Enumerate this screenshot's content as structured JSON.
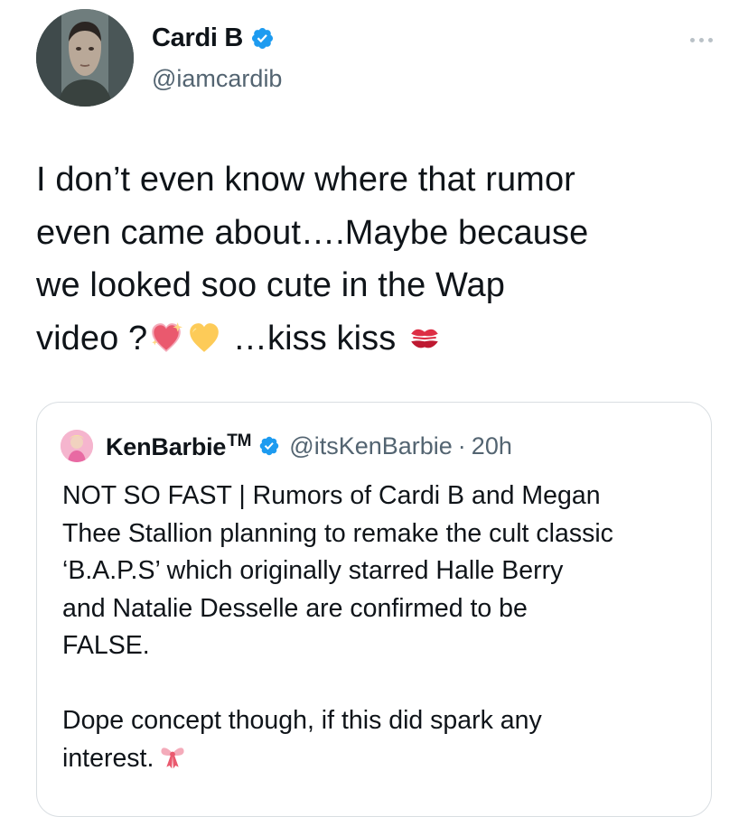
{
  "tweet": {
    "author_name": "Cardi B",
    "author_handle": "@iamcardib",
    "text_main": "I don’t even know where that rumor\neven came about….Maybe because\nwe looked soo cute in the Wap\nvideo ?",
    "text_tail": " …kiss kiss ",
    "emojis": [
      "sparkling-heart",
      "yellow-heart",
      "kiss-mark"
    ]
  },
  "quote": {
    "author_name": "KenBarbie",
    "author_tm": "TM",
    "author_handle": "@itsKenBarbie",
    "separator": "·",
    "time": "20h",
    "text": "NOT SO FAST | Rumors of Cardi B and Megan\nThee Stallion planning to remake the cult classic\n‘B.A.P.S’ which originally starred Halle Berry\nand Natalie Desselle are confirmed to be\nFALSE.\n\nDope concept though, if this did spark any\ninterest.",
    "trailing_emoji": "ribbon"
  },
  "colors": {
    "text": "#0f1419",
    "secondary": "#536471",
    "verified": "#1d9bf0",
    "border": "#d9dee2"
  }
}
